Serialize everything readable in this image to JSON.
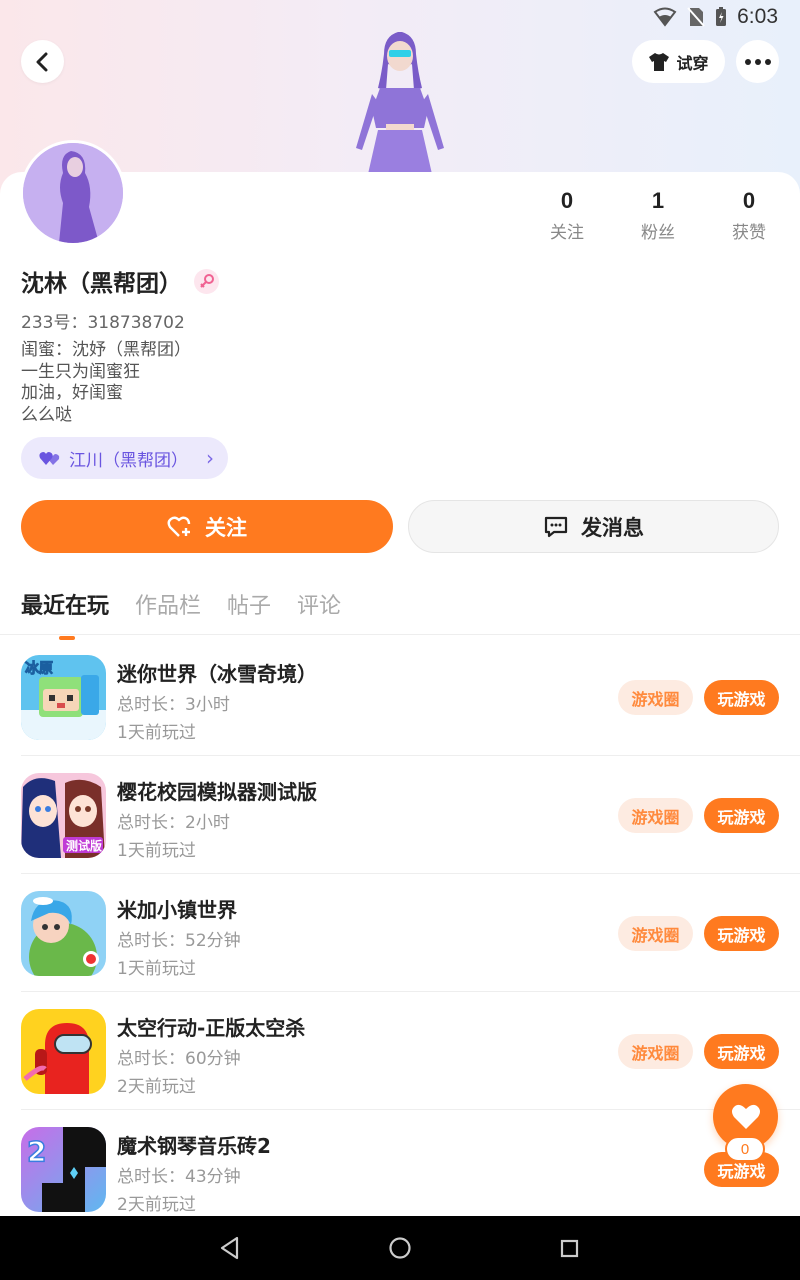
{
  "status": {
    "time": "6:03"
  },
  "header": {
    "tryon_label": "试穿"
  },
  "profile": {
    "name": "沈林（黑帮团）",
    "id_line": "233号：318738702",
    "bio": [
      "闺蜜：沈妤（黑帮团）",
      "一生只为闺蜜狂",
      "加油，好闺蜜",
      "么么哒"
    ],
    "bestie_label": "江川（黑帮团）"
  },
  "stats": [
    {
      "num": "0",
      "label": "关注"
    },
    {
      "num": "1",
      "label": "粉丝"
    },
    {
      "num": "0",
      "label": "获赞"
    }
  ],
  "actions": {
    "follow_label": "关注",
    "message_label": "发消息"
  },
  "tabs": [
    "最近在玩",
    "作品栏",
    "帖子",
    "评论"
  ],
  "games": [
    {
      "title": "迷你世界（冰雪奇境）",
      "duration": "总时长：3小时",
      "last_played": "1天前玩过",
      "circle_label": "游戏圈",
      "play_label": "玩游戏"
    },
    {
      "title": "樱花校园模拟器测试版",
      "duration": "总时长：2小时",
      "last_played": "1天前玩过",
      "circle_label": "游戏圈",
      "play_label": "玩游戏"
    },
    {
      "title": "米加小镇世界",
      "duration": "总时长：52分钟",
      "last_played": "1天前玩过",
      "circle_label": "游戏圈",
      "play_label": "玩游戏"
    },
    {
      "title": "太空行动-正版太空杀",
      "duration": "总时长：60分钟",
      "last_played": "2天前玩过",
      "circle_label": "游戏圈",
      "play_label": "玩游戏"
    },
    {
      "title": "魔术钢琴音乐砖2",
      "duration": "总时长：43分钟",
      "last_played": "2天前玩过",
      "circle_label": "",
      "play_label": "玩游戏"
    }
  ],
  "game_icon_text": {
    "g1": "冰原",
    "g2": "测试版",
    "g5": "2"
  },
  "float_like": {
    "count": "0"
  },
  "colors": {
    "accent": "#ff7a1f",
    "bestie": "#6a55e0"
  }
}
